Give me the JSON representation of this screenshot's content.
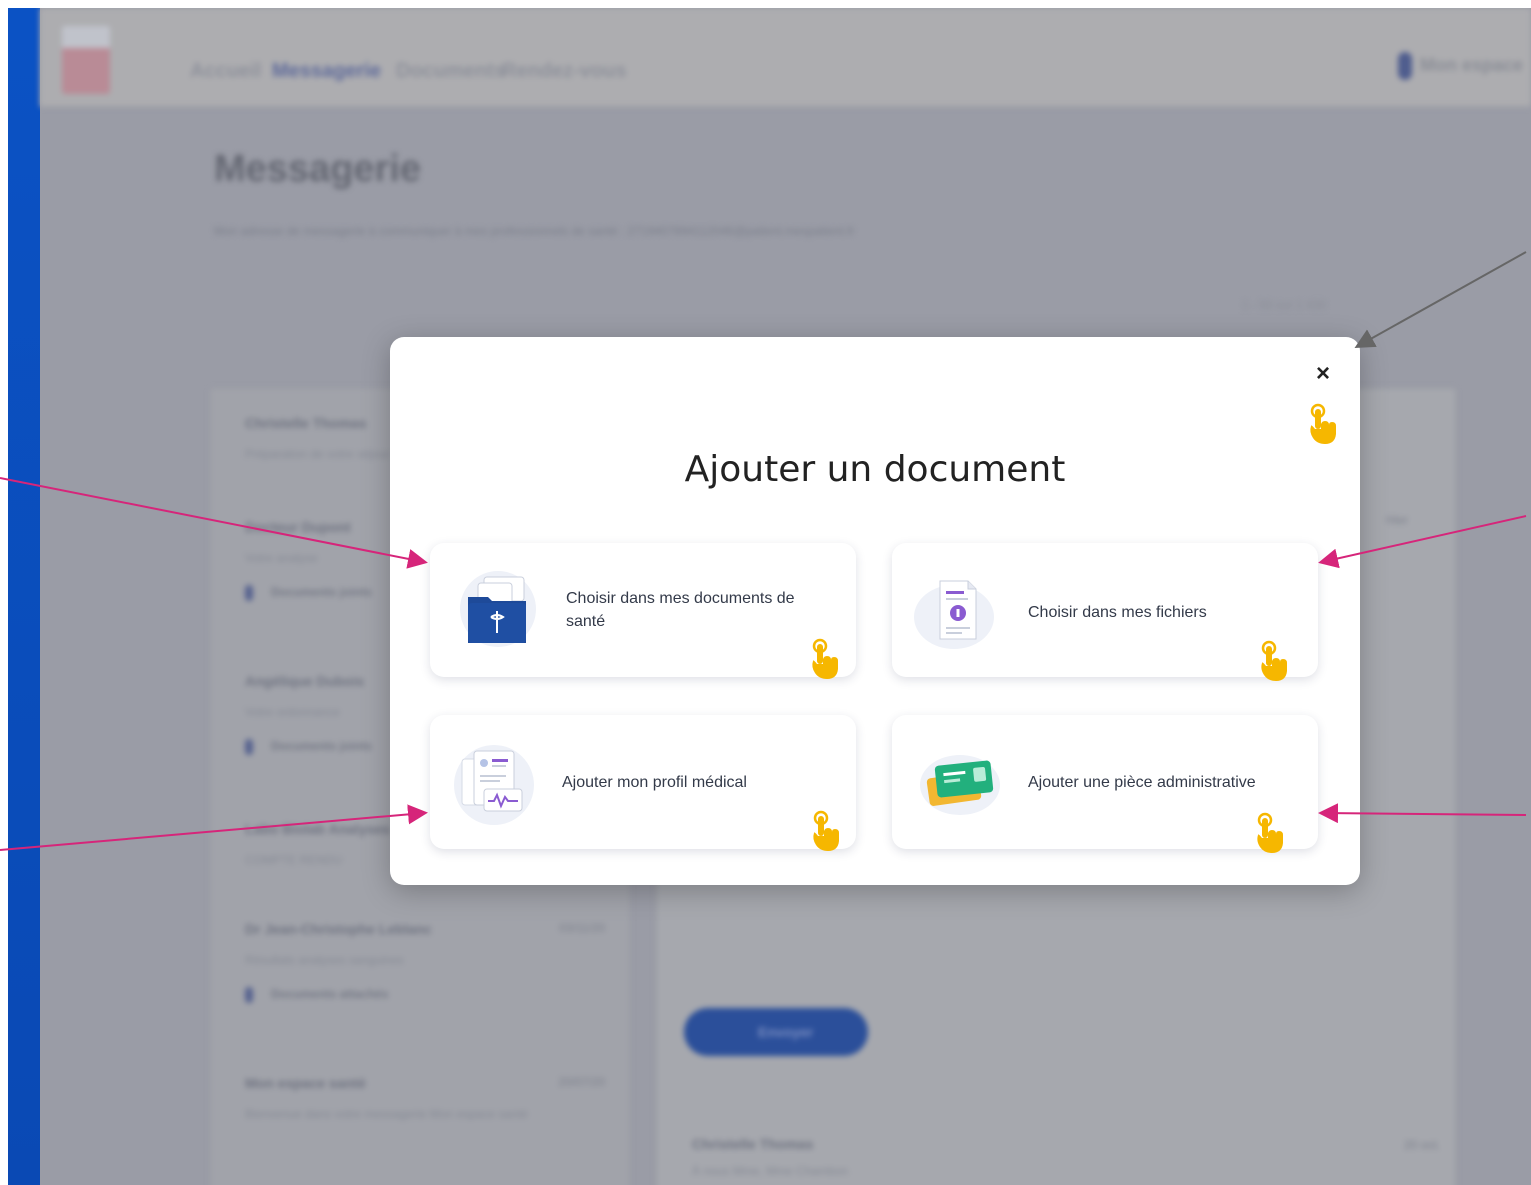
{
  "background": {
    "nav": [
      "Accueil",
      "Messagerie",
      "Documents",
      "Rendez-vous"
    ],
    "user_label": "Mon espace",
    "page_title": "Messagerie",
    "subtitle": "Mon adresse de messagerie à communiquer à mes professionnels de santé : 2719407894112046@patient.mespatient.fr",
    "pagination": "1 - 50 sur 1 430",
    "conversations": [
      {
        "name": "Christelle Thomas",
        "preview": "Préparation de votre séjour",
        "date": "",
        "attachment": ""
      },
      {
        "name": "Docteur Dupont",
        "preview": "Votre analyse",
        "date": "",
        "attachment": "Documents joints"
      },
      {
        "name": "Angélique Dubois",
        "preview": "Votre ordonnance",
        "date": "",
        "attachment": "Documents joints"
      },
      {
        "name": "Labo Biolab Analyses",
        "preview": "COMPTE RENDU",
        "date": "",
        "attachment": ""
      },
      {
        "name": "Dr Jean-Christophe Leblanc",
        "preview": "Résultats analyses sanguines",
        "date": "03/11/20",
        "attachment": "Documents attachés"
      },
      {
        "name": "Mon espace santé",
        "preview": "Bienvenue dans votre messagerie Mon espace santé",
        "date": "20/07/20",
        "attachment": ""
      }
    ],
    "send_button": "Envoyer",
    "footer": {
      "name": "Christelle Thomas",
      "sub": "À nous Mme, Mme Chambon",
      "date": "20 oct."
    },
    "right_date": "Hier"
  },
  "modal": {
    "title": "Ajouter un document",
    "close_icon": "×",
    "options": [
      {
        "label": "Choisir dans mes documents de santé",
        "icon": "medical-folder-icon"
      },
      {
        "label": "Choisir dans mes fichiers",
        "icon": "file-icon"
      },
      {
        "label": "Ajouter mon profil médical",
        "icon": "medical-profile-icon"
      },
      {
        "label": "Ajouter une pièce administrative",
        "icon": "id-card-icon"
      }
    ]
  },
  "colors": {
    "annotation_pink": "#d6257a",
    "annotation_gray": "#666666",
    "tap_yellow": "#f6b700",
    "brand_blue": "#0b52c4",
    "folder_blue": "#1e4a99"
  }
}
